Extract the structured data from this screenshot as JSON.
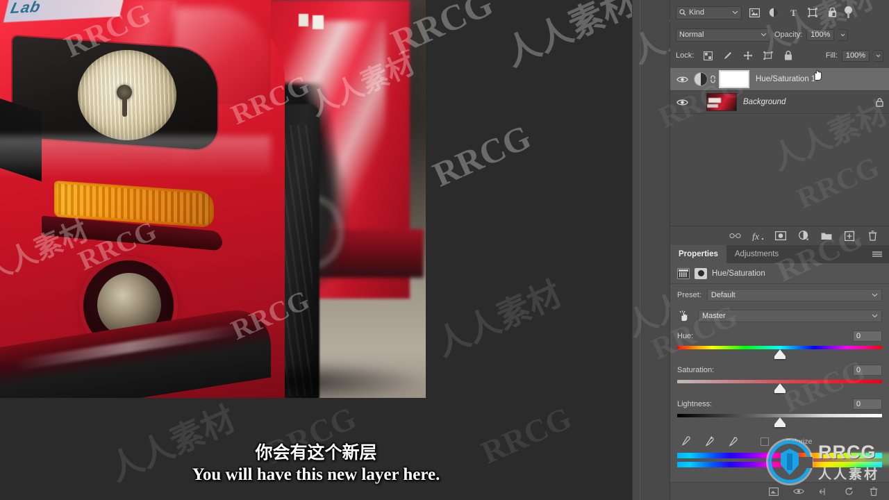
{
  "app": {
    "name": "Adobe Photoshop",
    "canvas_bg": "#2b2b2b",
    "panel_bg": "#4b4b4b",
    "properties_bg": "#545454"
  },
  "layers_panel": {
    "filter": {
      "kind_label": "Kind",
      "search_icon": "search-icon",
      "filter_icons": [
        {
          "name": "pixel-layer-filter-icon",
          "glyph": "image"
        },
        {
          "name": "adjustment-layer-filter-icon",
          "glyph": "half-circle"
        },
        {
          "name": "type-layer-filter-icon",
          "glyph": "T"
        },
        {
          "name": "shape-layer-filter-icon",
          "glyph": "shape"
        },
        {
          "name": "smart-object-filter-icon",
          "glyph": "smart"
        }
      ],
      "toggle_name": "filter-toggle-switch"
    },
    "blend": {
      "mode": "Normal",
      "opacity_label": "Opacity:",
      "opacity_value": "100%"
    },
    "lock": {
      "label": "Lock:",
      "icons": [
        {
          "name": "lock-transparent-pixels-icon"
        },
        {
          "name": "lock-image-pixels-icon"
        },
        {
          "name": "lock-position-icon"
        },
        {
          "name": "lock-artboard-nesting-icon"
        },
        {
          "name": "lock-all-icon"
        }
      ],
      "fill_label": "Fill:",
      "fill_value": "100%"
    },
    "layers": [
      {
        "name": "Hue/Saturation 1",
        "type": "adjustment",
        "selected": true,
        "visible": true,
        "linked": true,
        "locked": false,
        "italic": false
      },
      {
        "name": "Background",
        "type": "pixel",
        "selected": false,
        "visible": true,
        "linked": false,
        "locked": true,
        "italic": true
      }
    ],
    "toolbar_icons": [
      {
        "name": "link-layers-icon"
      },
      {
        "name": "layer-style-fx-icon",
        "label": "fx"
      },
      {
        "name": "add-layer-mask-icon"
      },
      {
        "name": "new-adjustment-layer-icon"
      },
      {
        "name": "new-group-icon"
      },
      {
        "name": "new-layer-icon"
      },
      {
        "name": "delete-layer-icon"
      }
    ]
  },
  "properties_panel": {
    "tabs": [
      {
        "label": "Properties",
        "active": true
      },
      {
        "label": "Adjustments",
        "active": false
      }
    ],
    "menu_icon": "panel-menu-icon",
    "header_title": "Hue/Saturation",
    "preset_label": "Preset:",
    "preset_value": "Default",
    "channel_value": "Master",
    "targeted_adjust_icon": "hand-targeted-adjustment-icon",
    "sliders": [
      {
        "label": "Hue:",
        "value": "0",
        "knob_pct": 50,
        "track": "hue"
      },
      {
        "label": "Saturation:",
        "value": "0",
        "knob_pct": 50,
        "track": "saturation"
      },
      {
        "label": "Lightness:",
        "value": "0",
        "knob_pct": 50,
        "track": "lightness"
      }
    ],
    "eyedroppers": [
      {
        "name": "eyedropper-sample-icon"
      },
      {
        "name": "eyedropper-add-to-sample-icon"
      },
      {
        "name": "eyedropper-subtract-from-sample-icon"
      }
    ],
    "colorize_label": "Colorize",
    "footer_icons": [
      {
        "name": "clip-to-layer-icon"
      },
      {
        "name": "toggle-visibility-icon"
      },
      {
        "name": "preview-previous-state-icon"
      },
      {
        "name": "reset-adjustment-icon"
      },
      {
        "name": "delete-adjustment-icon"
      }
    ]
  },
  "subtitles": {
    "chinese": "你会有这个新层",
    "english": "You will have this new layer here."
  },
  "watermarks": {
    "brand": "RRCG",
    "cjk": "人人素材",
    "logo_text": "RRCG",
    "logo_sub": "人人素材",
    "accent": "#1aa3e8"
  },
  "document": {
    "photo_subject": "red sports car front end close-up",
    "decal_text": "Lab"
  }
}
